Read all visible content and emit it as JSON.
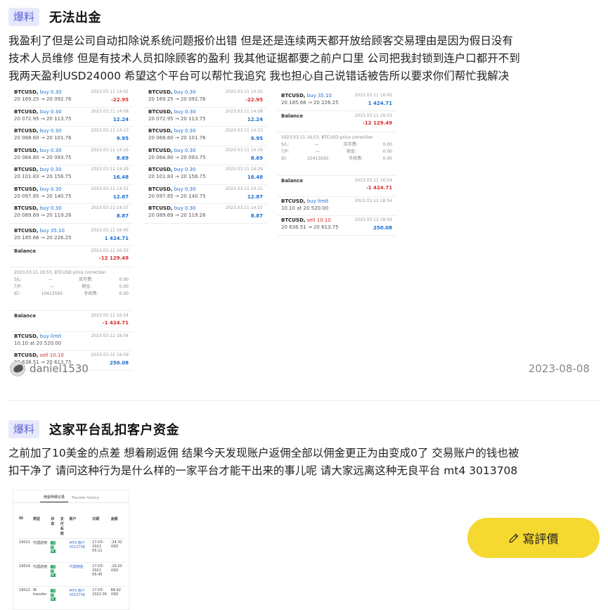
{
  "posts": [
    {
      "tag": "爆料",
      "title": "无法出金",
      "body_lines": [
        "我盈利了但是公司自动扣除说系统问题报价出错 但是还是连续两天都开放给顾客交易理由是因为假日没有",
        "技术人员维修 但是有技术人员扣除顾客的盈利 我其他证据都要之前户口里 公司把我封锁到连户口都开不到",
        "我两天盈利USD24000 希望这个平台可以帮忙我追究 我也担心自己说错话被告所以要求你们帮忙我解决"
      ],
      "author": "daniel1530",
      "date": "2023-08-08"
    },
    {
      "tag": "爆料",
      "title": "这家平台乱扣客户资金",
      "body_lines": [
        "之前加了10美金的点差 想着刷返佣 结果今天发现账户返佣全部以佣金更正为由变成0了 交易账户的钱也被",
        "扣干净了 请问这种行为是什么样的一家平台才能干出来的事儿呢 请大家远离这种无良平台 mt4 3013708"
      ]
    }
  ],
  "screenshot1": {
    "trades_a": [
      {
        "sym": "BTCUSD,",
        "side": "buy 0.30",
        "dt": "2023.03.11 14:02",
        "pr": "20 169.25 → 20 092.76",
        "pl": "-22.95"
      },
      {
        "sym": "BTCUSD,",
        "side": "buy 0.30",
        "dt": "2023.03.11 14:08",
        "pr": "20 072.95 → 20 113.75",
        "pl": "12.24"
      },
      {
        "sym": "BTCUSD,",
        "side": "buy 0.30",
        "dt": "2023.03.11 14:13",
        "pr": "20 068.60 → 20 101.76",
        "pl": "9.95"
      },
      {
        "sym": "BTCUSD,",
        "side": "buy 0.30",
        "dt": "2023.03.11 14:16",
        "pr": "20 064.80 → 20 093.75",
        "pl": "8.69"
      },
      {
        "sym": "BTCUSD,",
        "side": "buy 0.30",
        "dt": "2023.03.11 14:29",
        "pr": "20 101.83 → 20 156.75",
        "pl": "16.48"
      },
      {
        "sym": "BTCUSD,",
        "side": "buy 0.30",
        "dt": "2023.03.11 14:31",
        "pr": "20 097.85 → 20 140.75",
        "pl": "12.87"
      },
      {
        "sym": "BTCUSD,",
        "side": "buy 0.30",
        "dt": "2023.03.11 14:37",
        "pr": "20 089.69 → 20 119.26",
        "pl": "8.87"
      }
    ],
    "tail": {
      "t1": {
        "sym": "BTCUSD,",
        "side": "buy 35.10",
        "dt": "2023.03.11 16:45",
        "pr": "20 185.66 → 20 226.25",
        "pl": "1 424.71"
      },
      "bal1": {
        "lbl": "Balance",
        "dt": "2023.03.11 16:53",
        "pl": "-12 129.49"
      },
      "corr_title": "2023.03.11 16:53, BTCUSD price correction",
      "corr_rows": [
        {
          "k": "S/L:",
          "m": "—",
          "k2": "库存费:",
          "v": "0.00"
        },
        {
          "k": "T/P:",
          "m": "—",
          "k2": "佣金:",
          "v": "0.00"
        },
        {
          "k": "ID:",
          "m": "10413565",
          "k2": "手续费:",
          "v": "0.00"
        }
      ],
      "bal2": {
        "lbl": "Balance",
        "dt": "2023.03.11 16:54",
        "pl": "-1 424.71"
      },
      "t2": {
        "sym": "BTCUSD,",
        "side": "buy limit",
        "dt": "2023.03.12 18:54",
        "pr": "10.10 at 20 520.00",
        "pl": ""
      },
      "t3": {
        "sym": "BTCUSD,",
        "side": "sell 10.10",
        "dt": "2023.03.12 18:59",
        "pr": "20 638.51 → 20 613.75",
        "pl": "250.08"
      }
    }
  },
  "screenshot2": {
    "tabs": [
      "佣金明细记录",
      "Transfer history"
    ],
    "headers": [
      "ID",
      "类型",
      "状态",
      "支付系统",
      "账户",
      "日期",
      "金额"
    ],
    "rows": [
      [
        "19021",
        "代理返佣",
        "已完成",
        "",
        "MT4 账户 3013708",
        "17-03-2022 05:11",
        "-24.32 USD"
      ],
      [
        "19014",
        "代理返佣",
        "已完成",
        "",
        "代理佣金",
        "17-03-2022 05:45",
        "-16.20 USD"
      ],
      [
        "19012",
        "IB transfer",
        "已完成",
        "",
        "MT4 账户 3013708",
        "17-03-2022 05:",
        "84.92 USD"
      ]
    ]
  },
  "review_button": {
    "label": "寫評價",
    "icon": "pen-icon"
  },
  "colors": {
    "tag_bg": "#e7e9fb",
    "tag_text": "#5b62d6",
    "button_bg": "#f5d830"
  }
}
